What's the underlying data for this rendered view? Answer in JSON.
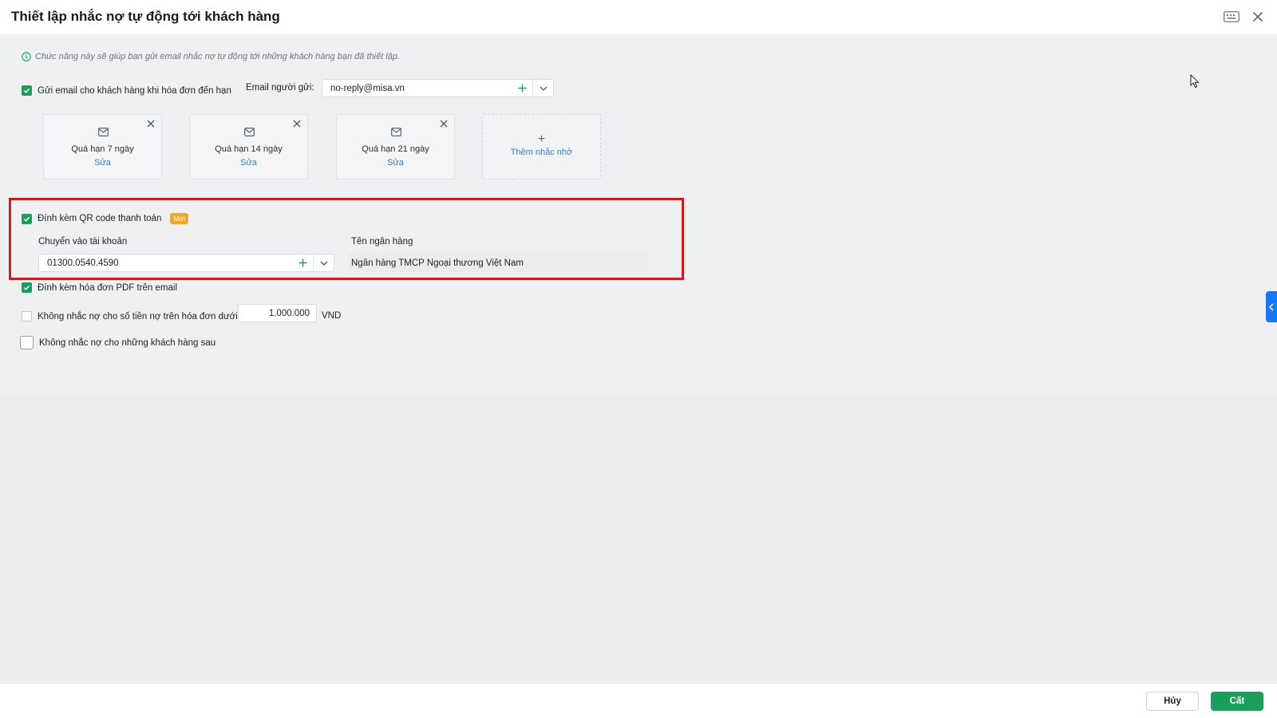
{
  "dialog": {
    "title": "Thiết lập nhắc nợ tự động tới khách hàng"
  },
  "info": {
    "text": "Chức năng này sẽ giúp bạn gửi email nhắc nợ tự động tới những khách hàng bạn đã thiết lập."
  },
  "send_email": {
    "label": "Gửi email cho khách hàng khi hóa đơn đến hạn",
    "checked": true,
    "sender_label": "Email người gửi:",
    "sender_value": "no-reply@misa.vn"
  },
  "reminders": [
    {
      "name": "Quá hạn 7 ngày",
      "edit": "Sửa"
    },
    {
      "name": "Quá hạn 14 ngày",
      "edit": "Sửa"
    },
    {
      "name": "Quá hạn 21 ngày",
      "edit": "Sửa"
    }
  ],
  "add_reminder": {
    "plus": "+",
    "label": "Thêm nhắc nhở"
  },
  "qr": {
    "label": "Đính kèm QR code thanh toán",
    "checked": true,
    "badge": "Mới",
    "account_label": "Chuyển vào tài khoản",
    "account_value": "01300.0540.4590",
    "bank_label": "Tên ngân hàng",
    "bank_value": "Ngân hàng TMCP Ngoại thương Việt Nam"
  },
  "pdf": {
    "label": "Đính kèm hóa đơn PDF trên email",
    "checked": true
  },
  "min_amount": {
    "label": "Không nhắc nợ cho số tiền nợ trên hóa đơn dưới",
    "checked": false,
    "value": "1.000.000",
    "currency": "VND"
  },
  "exclude_customers": {
    "label": "Không nhắc nợ cho những khách hàng sau",
    "checked": false
  },
  "footer": {
    "cancel": "Hủy",
    "save": "Cất"
  },
  "colors": {
    "accent_green": "#1a9e5b",
    "link_blue": "#3a7bd5",
    "highlight_red": "#d9161c",
    "badge_orange": "#f5a623"
  }
}
